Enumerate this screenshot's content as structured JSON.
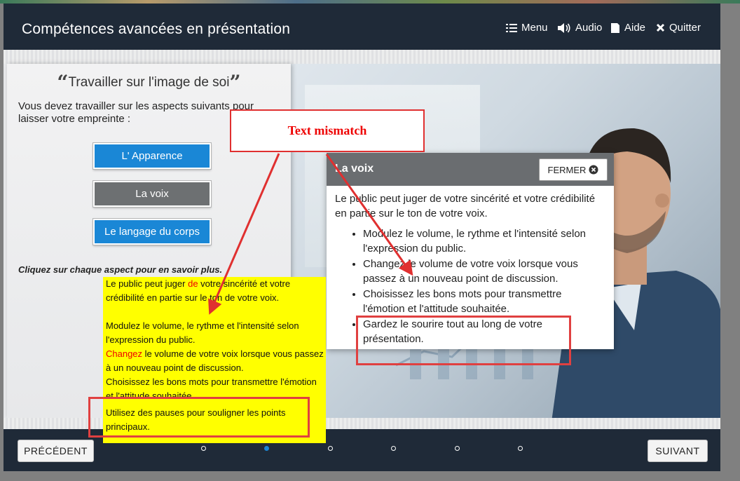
{
  "header": {
    "title": "Compétences avancées en présentation",
    "nav": [
      {
        "label": "Menu",
        "icon": "list-icon"
      },
      {
        "label": "Audio",
        "icon": "speaker-icon"
      },
      {
        "label": "Aide",
        "icon": "document-icon"
      },
      {
        "label": "Quitter",
        "icon": "close-icon"
      }
    ]
  },
  "left_panel": {
    "title": "Travailler sur l'image de soi",
    "intro": "Vous devez travailler sur les aspects suivants pour laisser votre empreinte :",
    "buttons": [
      "L' Apparence",
      "La voix",
      "Le langage du corps"
    ],
    "hint": "Cliquez sur chaque aspect pour en savoir plus."
  },
  "popup": {
    "title": "La voix",
    "close_label": "FERMER",
    "intro": "Le public peut juger de votre sincérité et votre crédibilité en partie sur le ton de votre voix.",
    "bullets": [
      "Modulez le volume, le rythme et l'intensité selon l'expression du public.",
      "Changez le volume de votre voix lorsque vous passez à un nouveau point de discussion.",
      "Choisissez les bons mots pour transmettre l'émotion et l'attitude souhaitée.",
      "Gardez le sourire tout au long de votre présentation."
    ]
  },
  "annotation": {
    "callout": "Text mismatch",
    "note": {
      "p1_a": "Le public peut juger ",
      "p1_red": "de",
      "p1_b": " votre sincérité et votre crédibilité en partie sur le ton de votre voix.",
      "p2": "Modulez le volume, le rythme et l'intensité selon l'expression du public.",
      "p3_red": "Changez",
      "p3_b": " le volume de votre voix lorsque vous passez à un nouveau point de discussion.",
      "p4": "Choisissez les bons mots pour transmettre l'émotion et l'attitude souhaitée.",
      "p5": "Utilisez des pauses pour souligner les points principaux."
    }
  },
  "footer": {
    "prev": "PRÉCÉDENT",
    "next": "SUIVANT",
    "page_count": 6,
    "active_page": 2
  },
  "colors": {
    "header_bg": "#1f2a38",
    "accent_blue": "#1a87d6",
    "button_grey": "#6d7072",
    "annotation_red": "#e03030",
    "note_yellow": "#ffff00"
  }
}
